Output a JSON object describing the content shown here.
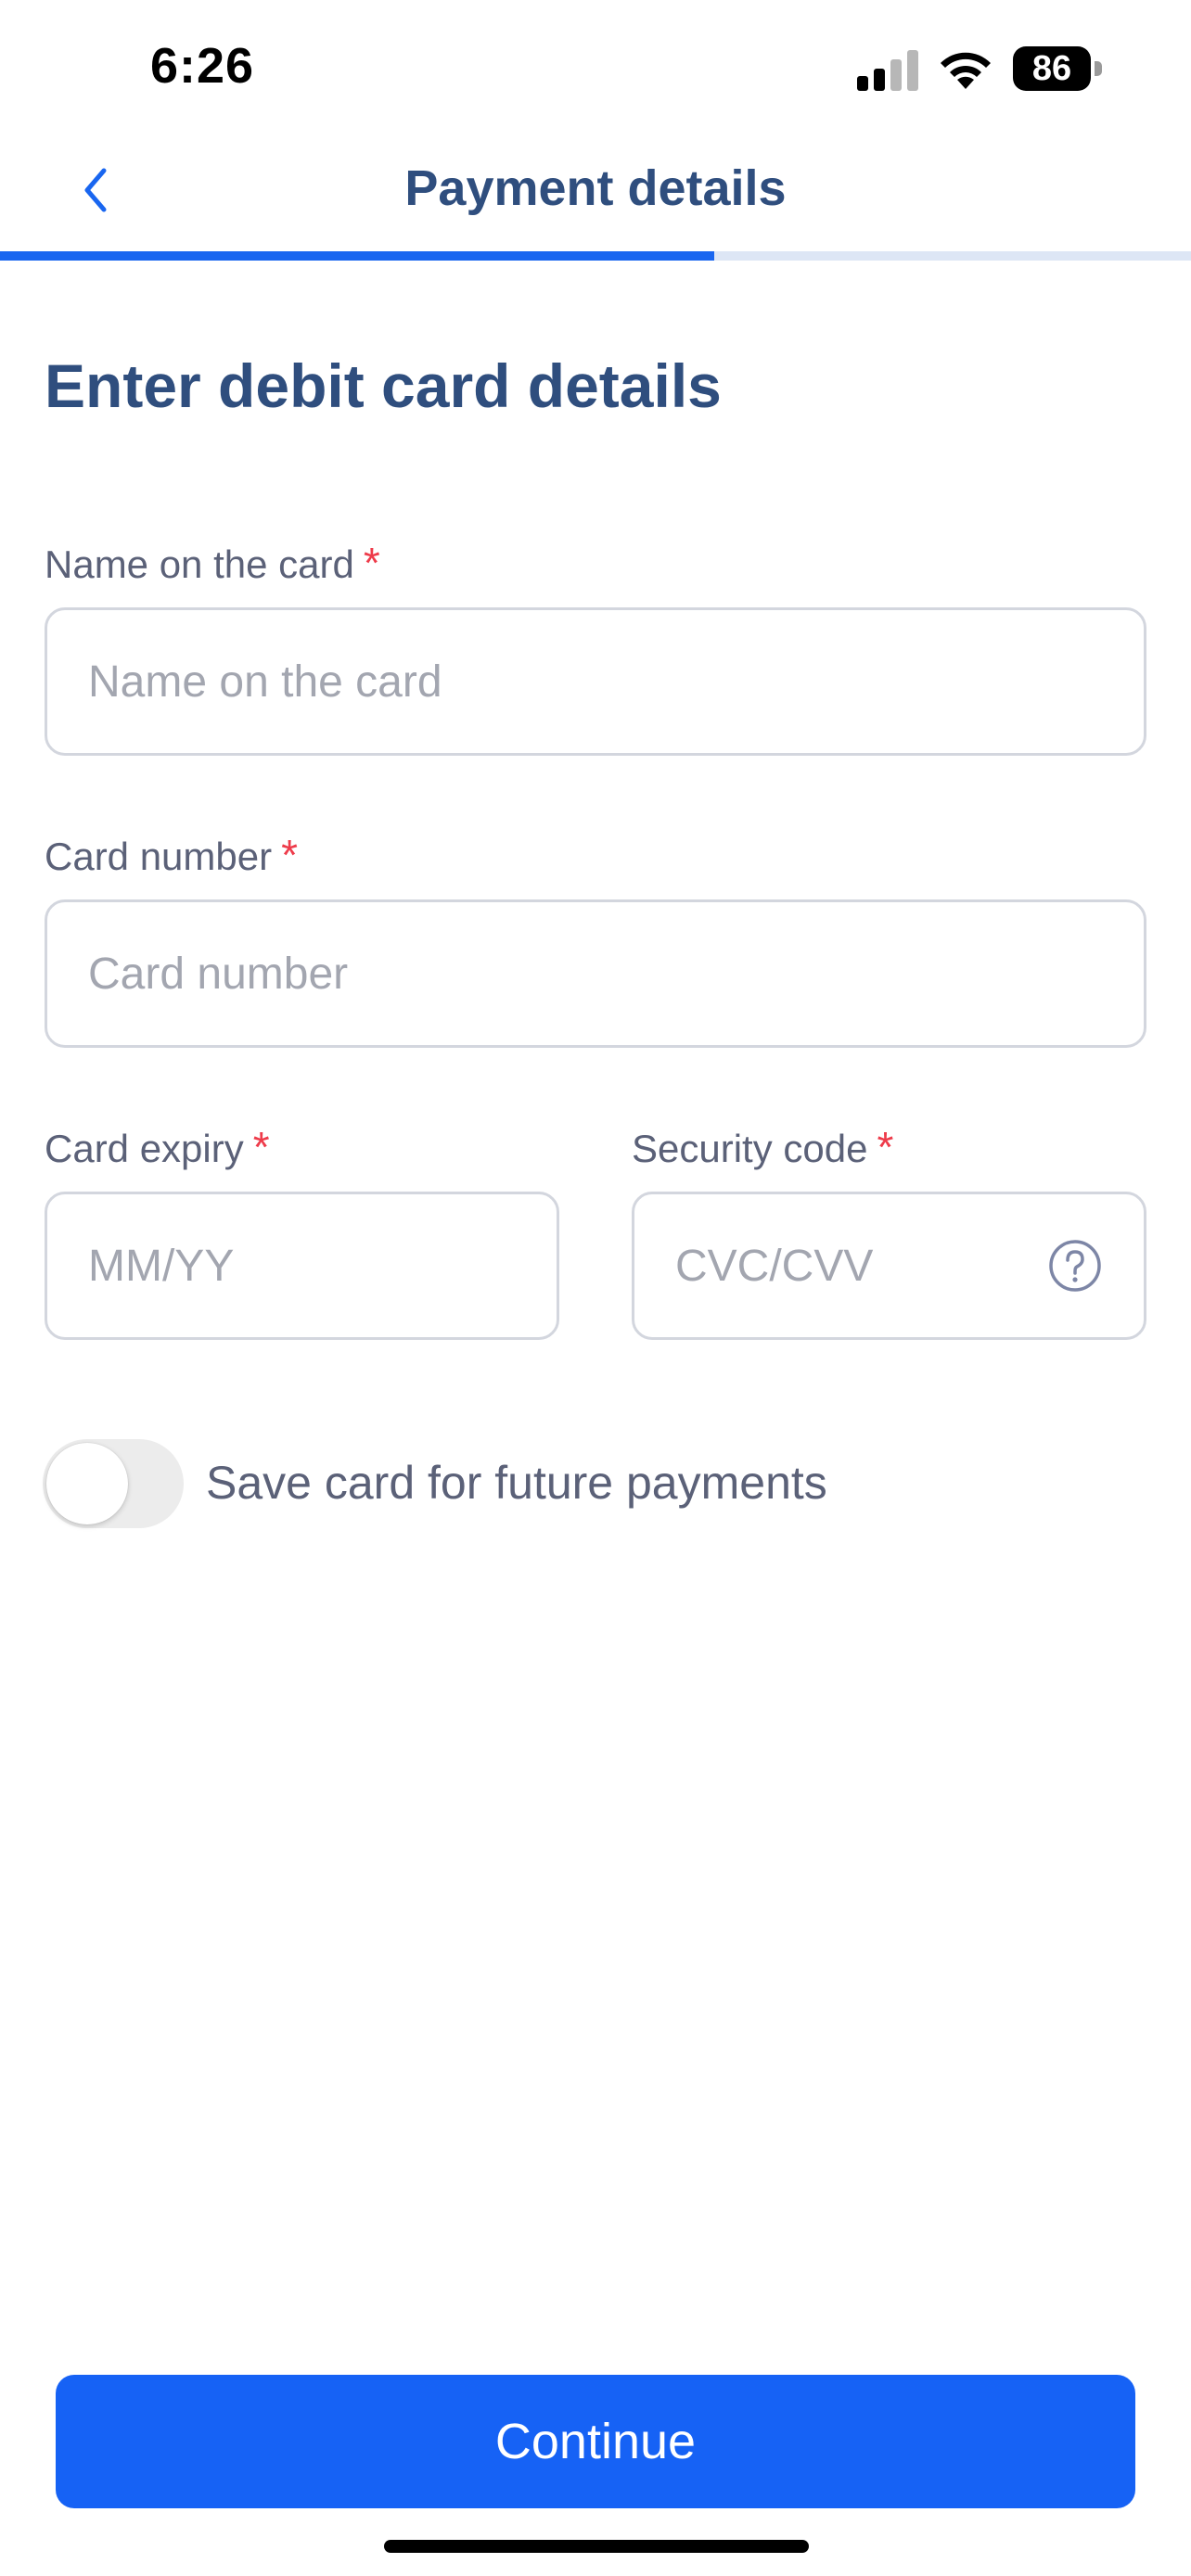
{
  "status_bar": {
    "time": "6:26",
    "battery_level": "86",
    "icons": [
      "signal-icon",
      "wifi-icon",
      "battery-icon"
    ]
  },
  "header": {
    "title": "Payment details",
    "back_icon": "chevron-left-icon",
    "progress_fraction": 0.6
  },
  "form": {
    "heading": "Enter debit card details",
    "required_marker": "*",
    "name_on_card": {
      "label": "Name on the card",
      "placeholder": "Name on the card",
      "value": ""
    },
    "card_number": {
      "label": "Card number",
      "placeholder": "Card number",
      "value": ""
    },
    "card_expiry": {
      "label": "Card expiry",
      "placeholder": "MM/YY",
      "value": ""
    },
    "security_code": {
      "label": "Security code",
      "placeholder": "CVC/CVV",
      "value": "",
      "help_icon": "question-circle-icon"
    },
    "save_card": {
      "label": "Save card for future payments",
      "enabled": false
    }
  },
  "footer": {
    "continue_label": "Continue"
  },
  "colors": {
    "accent": "#1662f5",
    "heading": "#2f4e7e",
    "required": "#ee3b4a",
    "label": "#5b6178",
    "placeholder": "#a3a6b0",
    "border": "#d3d6de",
    "progress_track": "#dde6f5"
  }
}
